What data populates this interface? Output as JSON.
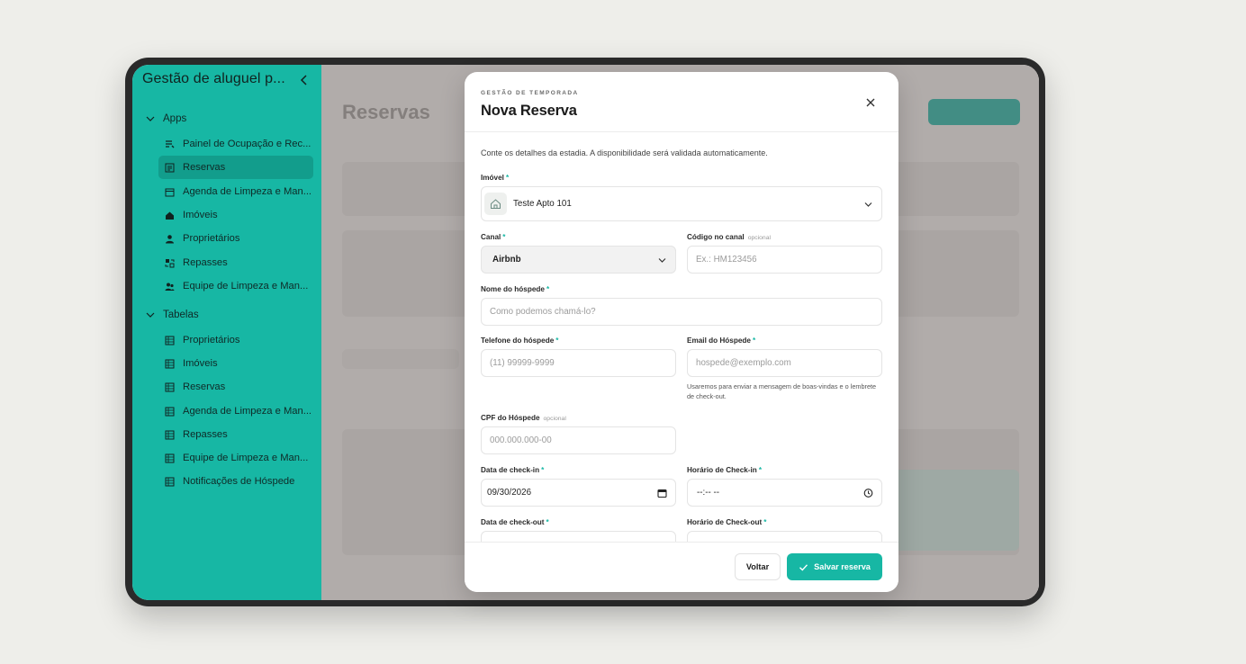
{
  "sidebar": {
    "app_title": "Gestão de aluguel p...",
    "apps_label": "Apps",
    "apps_items": [
      {
        "label": "Painel de Ocupação e Rec...",
        "icon": "dashboard-icon"
      },
      {
        "label": "Reservas",
        "icon": "list-icon"
      },
      {
        "label": "Agenda de Limpeza e Man...",
        "icon": "calendar-icon"
      },
      {
        "label": "Imóveis",
        "icon": "home-icon"
      },
      {
        "label": "Proprietários",
        "icon": "person-icon"
      },
      {
        "label": "Repasses",
        "icon": "transfer-icon"
      },
      {
        "label": "Equipe de Limpeza e Man...",
        "icon": "team-icon"
      }
    ],
    "tables_label": "Tabelas",
    "tables_items": [
      {
        "label": "Proprietários"
      },
      {
        "label": "Imóveis"
      },
      {
        "label": "Reservas"
      },
      {
        "label": "Agenda de Limpeza e Man..."
      },
      {
        "label": "Repasses"
      },
      {
        "label": "Equipe de Limpeza e Man..."
      },
      {
        "label": "Notificações de Hóspede"
      }
    ]
  },
  "background": {
    "page_title": "Reservas"
  },
  "modal": {
    "eyebrow": "GESTÃO DE TEMPORADA",
    "title": "Nova Reserva",
    "description": "Conte os detalhes da estadia. A disponibilidade será validada automaticamente.",
    "required_mark": "*",
    "optional_label": "opcional",
    "imovel": {
      "label": "Imóvel",
      "value": "Teste Apto 101"
    },
    "canal": {
      "label": "Canal",
      "value": "Airbnb"
    },
    "codigo": {
      "label": "Código no canal",
      "placeholder": "Ex.: HM123456"
    },
    "nome": {
      "label": "Nome do hóspede",
      "placeholder": "Como podemos chamá-lo?"
    },
    "telefone": {
      "label": "Telefone do hóspede",
      "placeholder": "(11) 99999-9999"
    },
    "email": {
      "label": "Email do Hóspede",
      "placeholder": "hospede@exemplo.com",
      "hint": "Usaremos para enviar a mensagem de boas-vindas e o lembrete de check-out."
    },
    "cpf": {
      "label": "CPF do Hóspede",
      "placeholder": "000.000.000-00"
    },
    "checkin_date": {
      "label": "Data de check-in",
      "value": "09/30/2026"
    },
    "checkin_time": {
      "label": "Horário de Check-in",
      "value": "--:-- --"
    },
    "checkout_date": {
      "label": "Data de check-out"
    },
    "checkout_time": {
      "label": "Horário de Check-out"
    },
    "back_label": "Voltar",
    "save_label": "Salvar reserva"
  },
  "colors": {
    "accent": "#17b7a4",
    "sidebar_active": "#129d8c"
  }
}
